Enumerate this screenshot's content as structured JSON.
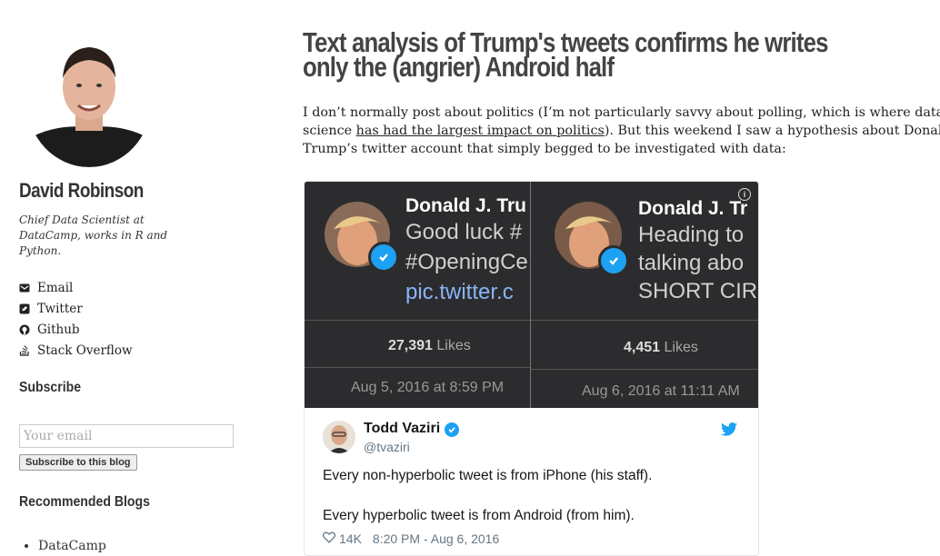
{
  "sidebar": {
    "author_name": "David Robinson",
    "bio": "Chief Data Scientist at DataCamp, works in R and Python.",
    "links": [
      {
        "label": "Email",
        "icon": "envelope-icon"
      },
      {
        "label": "Twitter",
        "icon": "twitter-icon"
      },
      {
        "label": "Github",
        "icon": "github-icon"
      },
      {
        "label": "Stack Overflow",
        "icon": "stack-overflow-icon"
      }
    ],
    "subscribe_heading": "Subscribe",
    "email_placeholder": "Your email",
    "subscribe_button": "Subscribe to this blog",
    "recommended_heading": "Recommended Blogs",
    "blogs": [
      "DataCamp"
    ]
  },
  "post": {
    "title": "Text analysis of Trump's tweets confirms he writes only the (angrier) Android half",
    "intro_1": "I don’t normally post about politics (I’m not particularly savvy about polling, which is where data",
    "intro_2a": "science ",
    "intro_2_link": "has had the largest impact on politics",
    "intro_2b": "). But this weekend I saw a hypothesis about Donald",
    "intro_3": "Trump’s twitter account that simply begged to be investigated with data:"
  },
  "embed": {
    "left": {
      "name": "Donald J. Tru",
      "lines": [
        "Good luck #",
        "#OpeningCe"
      ],
      "link": "pic.twitter.c",
      "likes_count": "27,391",
      "likes_label": "Likes",
      "date": "Aug 5, 2016 at 8:59 PM"
    },
    "right": {
      "name": "Donald J. Tr",
      "lines": [
        "Heading to",
        "talking abo",
        "SHORT CIR"
      ],
      "likes_count": "4,451",
      "likes_label": "Likes",
      "date": "Aug 6, 2016 at 11:11 AM"
    },
    "tweet": {
      "author": "Todd Vaziri",
      "handle": "@tvaziri",
      "line1": "Every non-hyperbolic tweet is from iPhone (his staff).",
      "line2": "Every hyperbolic tweet is from Android (from him).",
      "likes": "14K",
      "timestamp": "8:20 PM - Aug 6, 2016"
    }
  },
  "colors": {
    "twitter_blue": "#1da1f2",
    "dark_bg": "#2c2c2e"
  }
}
